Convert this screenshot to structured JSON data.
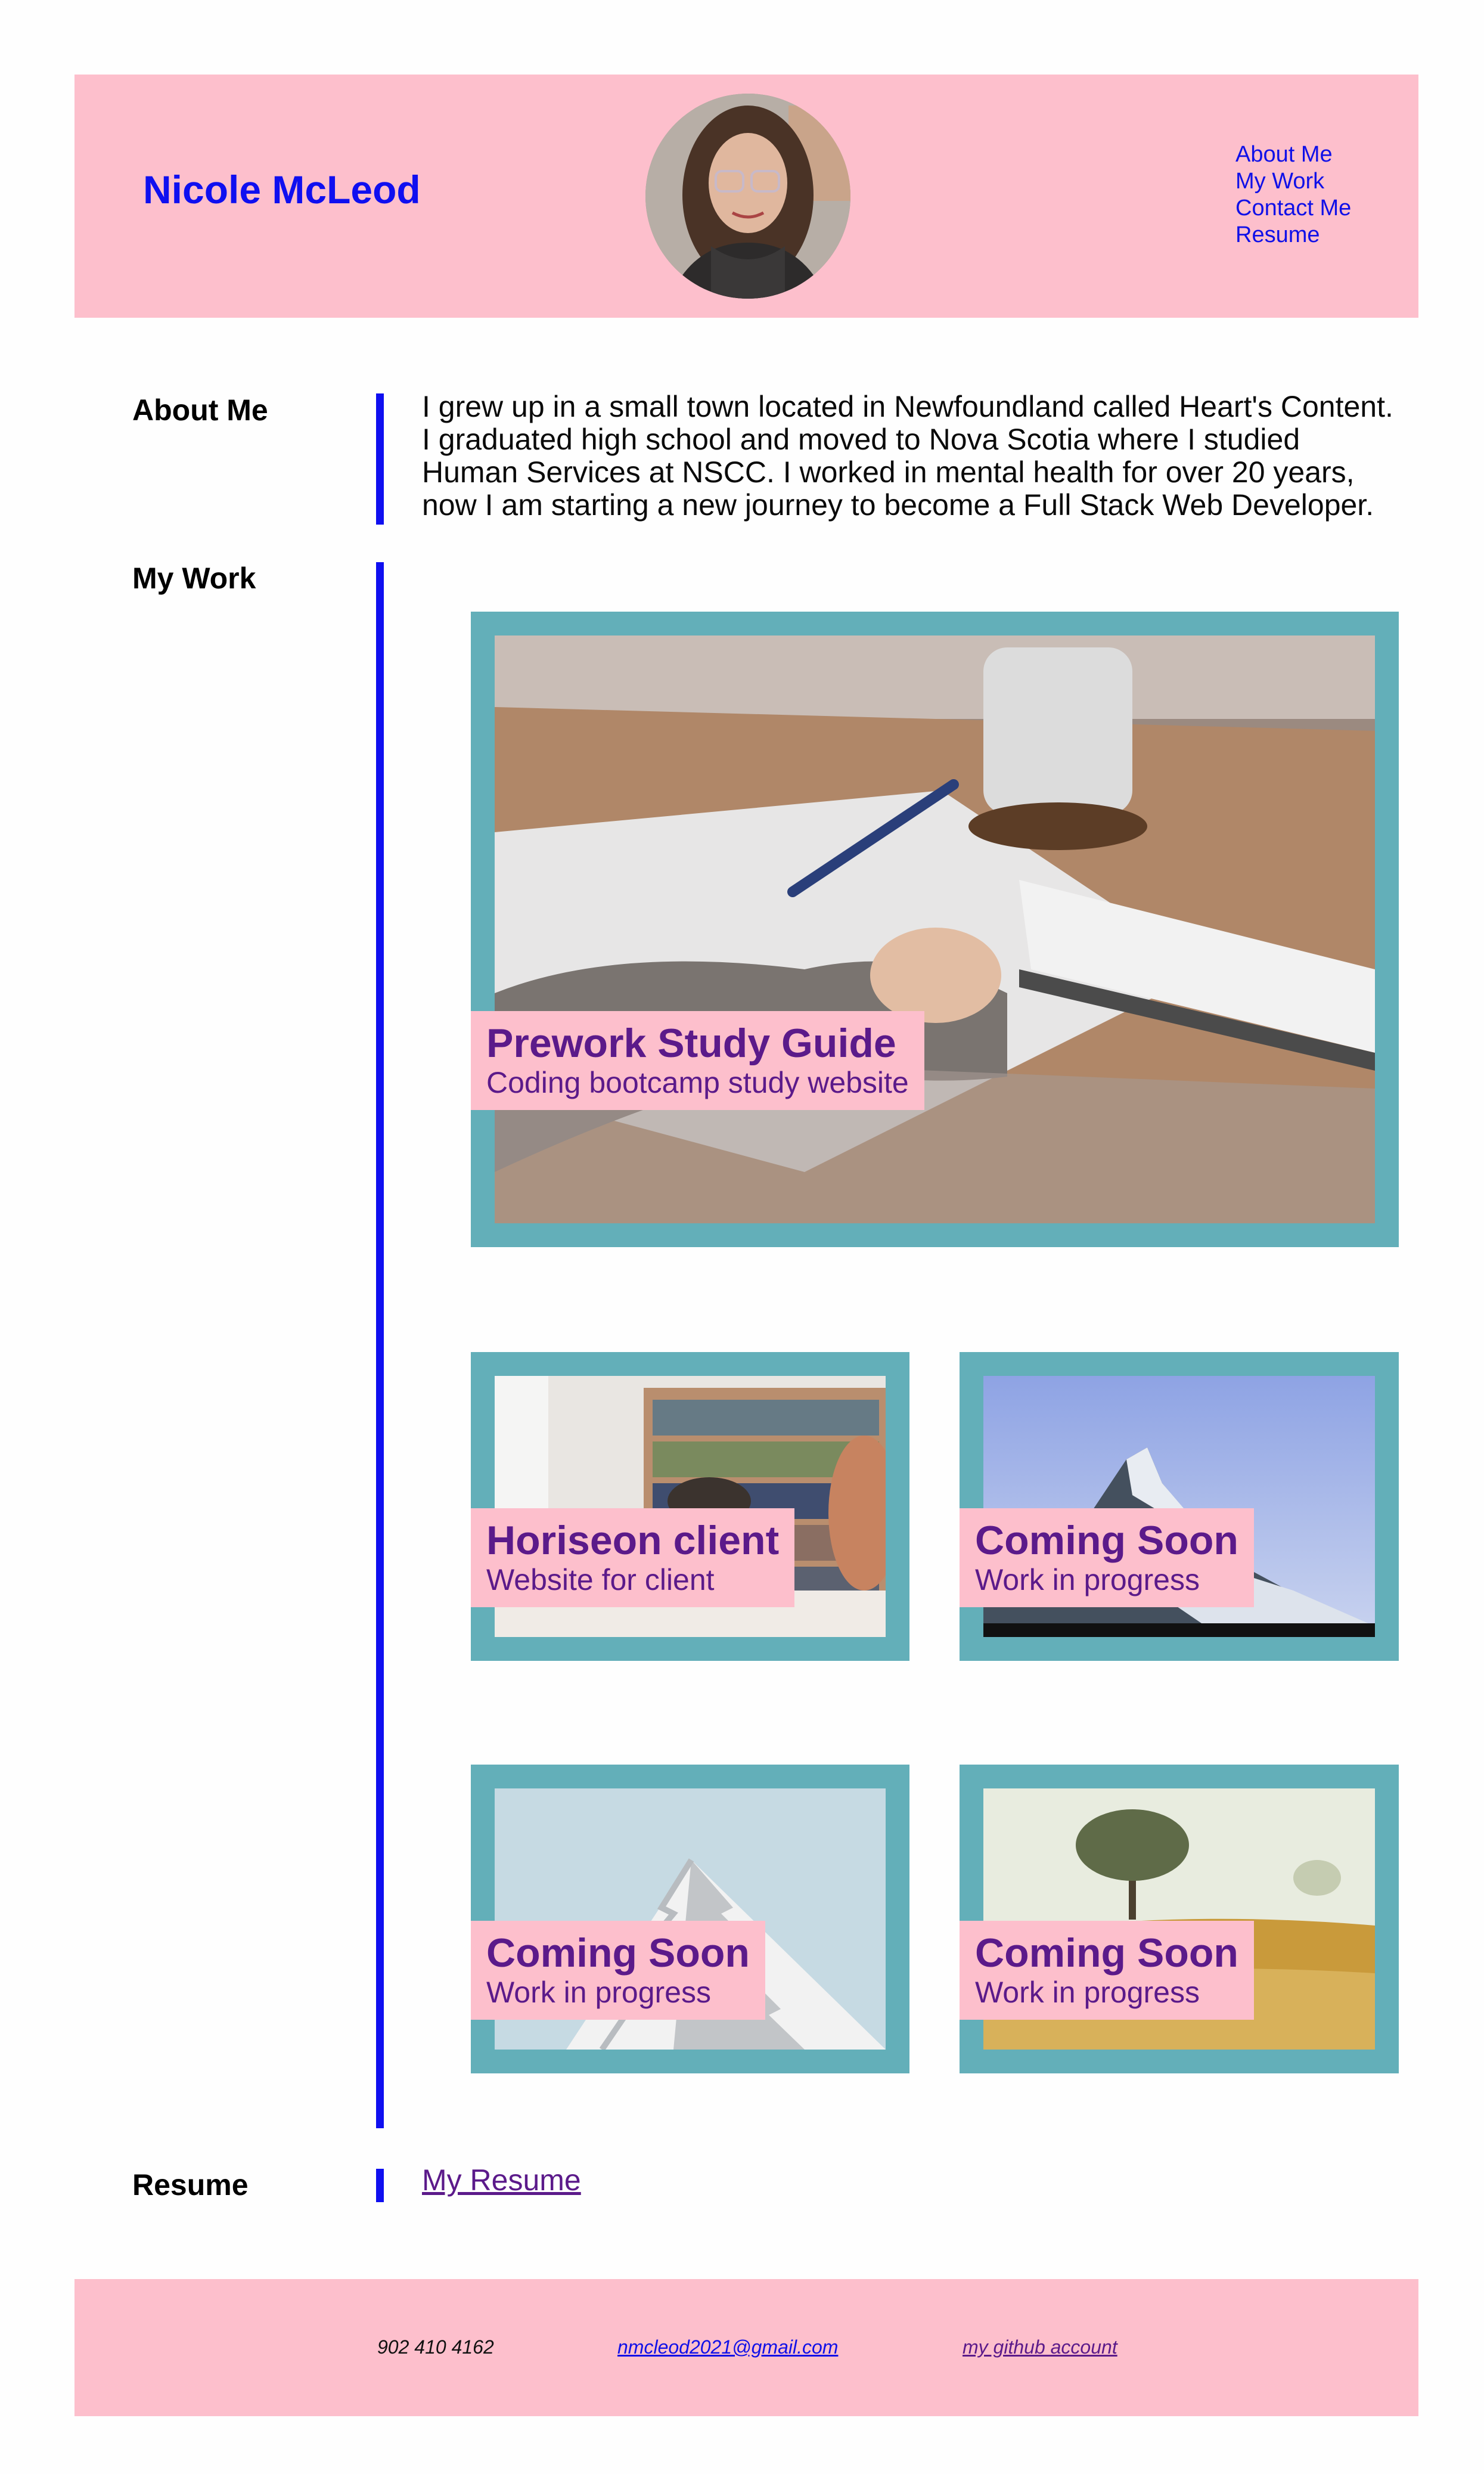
{
  "header": {
    "name": "Nicole McLeod",
    "nav": [
      "About Me",
      "My Work",
      "Contact Me",
      "Resume"
    ]
  },
  "about": {
    "label": "About Me",
    "text": "I grew up in a small town located in Newfoundland called Heart's Content. I graduated high school and moved to Nova Scotia where I studied Human Services at NSCC. I worked in mental health for over 20 years, now I am starting a new journey to become a Full Stack Web Developer."
  },
  "work": {
    "label": "My Work",
    "projects": [
      {
        "title": "Prework Study Guide",
        "subtitle": "Coding bootcamp study website"
      },
      {
        "title": "Horiseon client",
        "subtitle": "Website for client"
      },
      {
        "title": "Coming Soon",
        "subtitle": "Work in progress"
      },
      {
        "title": "Coming Soon",
        "subtitle": "Work in progress"
      },
      {
        "title": "Coming Soon",
        "subtitle": "Work in progress"
      }
    ]
  },
  "resume": {
    "label": "Resume",
    "link": "My Resume"
  },
  "footer": {
    "phone": "902 410 4162",
    "email": "nmcleod2021@gmail.com",
    "github": "my github account"
  },
  "colors": {
    "pink": "#fdbfcc",
    "blue": "#0f0ff0",
    "teal": "#63afb9",
    "purple": "#5b1a8a"
  }
}
